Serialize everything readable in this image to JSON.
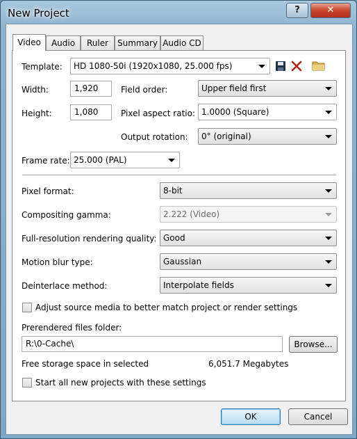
{
  "window": {
    "title": "New Project",
    "help": "?",
    "close": "✕"
  },
  "tabs": [
    "Video",
    "Audio",
    "Ruler",
    "Summary",
    "Audio CD"
  ],
  "template": {
    "label": "Template:",
    "value": "HD 1080-50i (1920x1080, 25.000 fps)"
  },
  "width": {
    "label": "Width:",
    "value": "1,920"
  },
  "height": {
    "label": "Height:",
    "value": "1,080"
  },
  "field_order": {
    "label": "Field order:",
    "value": "Upper field first"
  },
  "pixel_aspect": {
    "label": "Pixel aspect ratio:",
    "value": "1.0000 (Square)"
  },
  "output_rotation": {
    "label": "Output rotation:",
    "value": "0° (original)"
  },
  "frame_rate": {
    "label": "Frame rate:",
    "value": "25.000 (PAL)"
  },
  "pixel_format": {
    "label": "Pixel format:",
    "value": "8-bit"
  },
  "compositing_gamma": {
    "label": "Compositing gamma:",
    "value": "2.222 (Video)"
  },
  "render_quality": {
    "label": "Full-resolution rendering quality:",
    "value": "Good"
  },
  "motion_blur": {
    "label": "Motion blur type:",
    "value": "Gaussian"
  },
  "deinterlace": {
    "label": "Deinterlace method:",
    "value": "Interpolate fields"
  },
  "adjust_source": {
    "label": "Adjust source media to better match project or render settings",
    "checked": false
  },
  "prerendered": {
    "label": "Prerendered files folder:",
    "value": "R:\\0-Cache\\",
    "browse": "Browse..."
  },
  "free_storage": {
    "label": "Free storage space in selected",
    "value": "6,051.7 Megabytes"
  },
  "start_all": {
    "label": "Start all new projects with these settings",
    "checked": false
  },
  "buttons": {
    "ok": "OK",
    "cancel": "Cancel"
  },
  "icons": {
    "save": "floppy-disk-icon",
    "delete": "red-x-icon",
    "folder": "folder-icon"
  }
}
